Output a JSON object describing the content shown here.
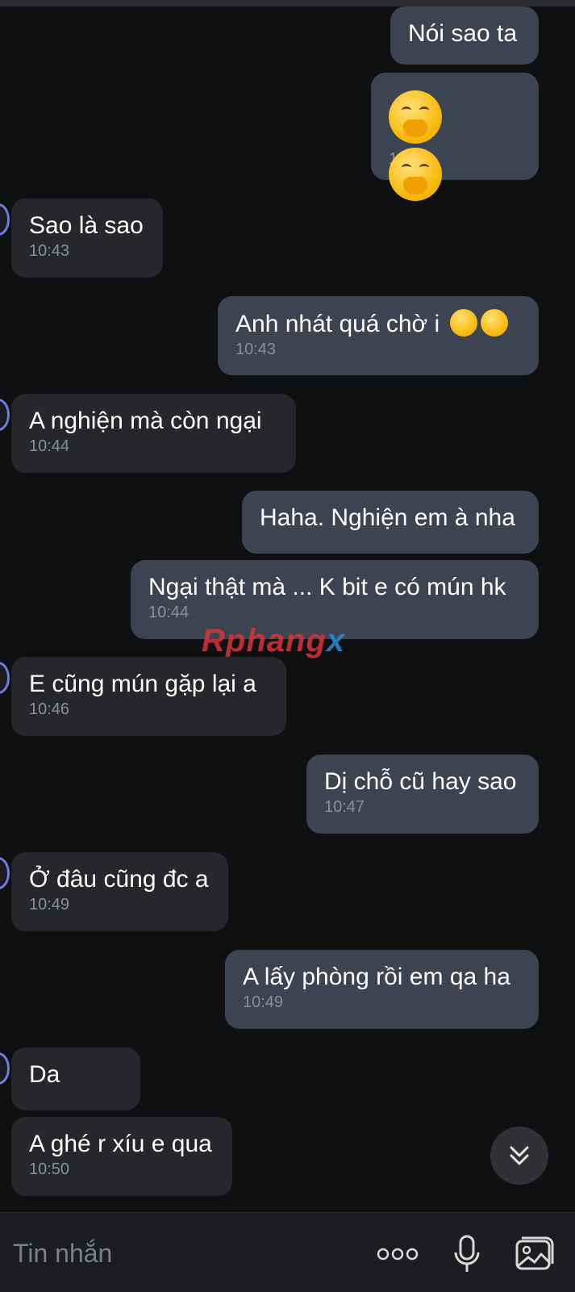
{
  "messages": [
    {
      "dir": "out",
      "text": "Nói sao ta",
      "time": ""
    },
    {
      "dir": "out",
      "type": "emoji",
      "emojis": [
        "hand-over-mouth-emoji",
        "hand-over-mouth-emoji"
      ],
      "time": "10:43"
    },
    {
      "dir": "in",
      "text": "Sao là sao",
      "time": "10:43"
    },
    {
      "dir": "out",
      "text": "Anh nhát quá chờ i",
      "time": "10:43",
      "trailing_emojis": 2
    },
    {
      "dir": "in",
      "text": "A nghiện mà còn ngại",
      "time": "10:44"
    },
    {
      "dir": "out",
      "text": "Haha. Nghiện em à nha",
      "time": ""
    },
    {
      "dir": "out",
      "text": "Ngại thật mà ... K bit e có mún hk",
      "time": "10:44"
    },
    {
      "dir": "in",
      "text": "E cũng mún gặp lại a",
      "time": "10:46"
    },
    {
      "dir": "out",
      "text": "Dị chỗ cũ hay sao",
      "time": "10:47"
    },
    {
      "dir": "in",
      "text": "Ở đâu cũng đc a",
      "time": "10:49"
    },
    {
      "dir": "out",
      "text": "A lấy phòng rồi em qa ha",
      "time": "10:49"
    },
    {
      "dir": "in",
      "text": "Da",
      "time": ""
    },
    {
      "dir": "in",
      "text": "A ghé r xíu e qua",
      "time": "10:50"
    }
  ],
  "watermark": {
    "part1": "Rphang",
    "part2": "x"
  },
  "composer": {
    "placeholder": "Tin nhắn",
    "icons": [
      "more-options-icon",
      "microphone-icon",
      "image-gallery-icon"
    ]
  },
  "scroll_button_icon": "chevron-double-down-icon",
  "colors": {
    "background": "#0f1012",
    "incoming": "#26272a",
    "outgoing": "#3b4450",
    "timestamp": "#8a9099"
  }
}
